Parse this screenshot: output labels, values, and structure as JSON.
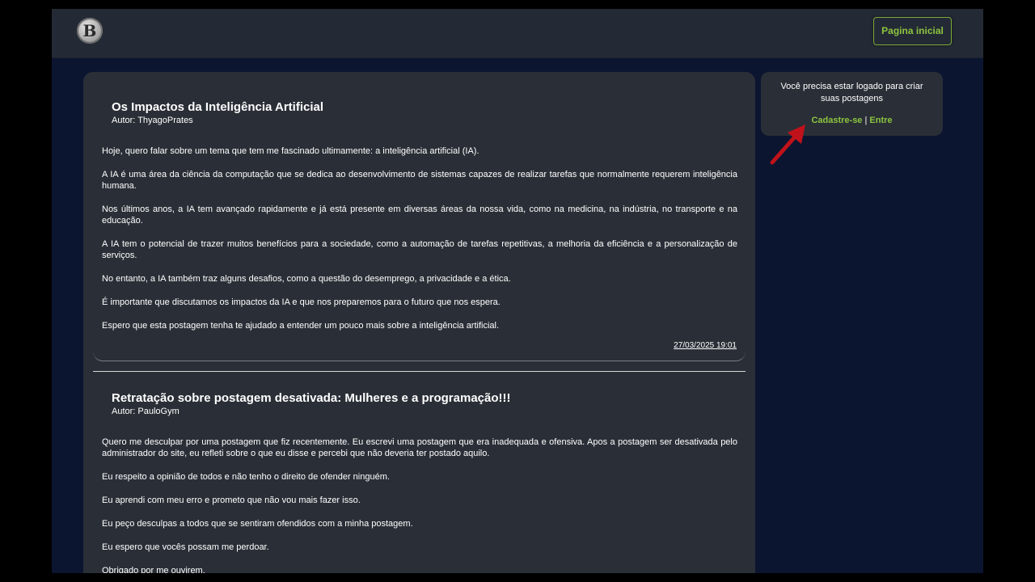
{
  "header": {
    "logo_letter": "B",
    "home_button": "Pagina inicial",
    "accent_color": "#8cc43f"
  },
  "posts": [
    {
      "title": "Os Impactos da Inteligência Artificial",
      "author": "Autor: ThyagoPrates",
      "paragraphs": [
        "Hoje, quero falar sobre um tema que tem me fascinado ultimamente: a inteligência artificial (IA).",
        "A IA é uma área da ciência da computação que se dedica ao desenvolvimento de sistemas capazes de realizar tarefas que normalmente requerem inteligência humana.",
        "Nos últimos anos, a IA tem avançado rapidamente e já está presente em diversas áreas da nossa vida, como na medicina, na indústria, no transporte e na educação.",
        "A IA tem o potencial de trazer muitos benefícios para a sociedade, como a automação de tarefas repetitivas, a melhoria da eficiência e a personalização de serviços.",
        "No entanto, a IA também traz alguns desafios, como a questão do desemprego, a privacidade e a ética.",
        "É importante que discutamos os impactos da IA e que nos preparemos para o futuro que nos espera.",
        "Espero que esta postagem tenha te ajudado a entender um pouco mais sobre a inteligência artificial."
      ],
      "date": "27/03/2025 19:01"
    },
    {
      "title": "Retratação sobre postagem desativada: Mulheres e a programação!!!",
      "author": "Autor: PauloGym",
      "paragraphs": [
        "Quero me desculpar por uma postagem que fiz recentemente. Eu escrevi uma postagem que era inadequada e ofensiva. Apos a postagem ser desativada pelo administrador do site, eu refleti sobre o que eu disse e percebi que não deveria ter postado aquilo.",
        "Eu respeito a opinião de todos e não tenho o direito de ofender ninguém.",
        "Eu aprendi com meu erro e prometo que não vou mais fazer isso.",
        "Eu peço desculpas a todos que se sentiram ofendidos com a minha postagem.",
        "Eu espero que vocês possam me perdoar.",
        "Obrigado por me ouvirem."
      ]
    }
  ],
  "sidebar": {
    "message": "Você precisa estar logado para criar suas postagens",
    "signup_link": "Cadastre-se",
    "separator": "|",
    "login_link": "Entre"
  },
  "annotation": {
    "arrow_color": "#c0121a",
    "arrow_icon": "red-arrow-icon"
  }
}
